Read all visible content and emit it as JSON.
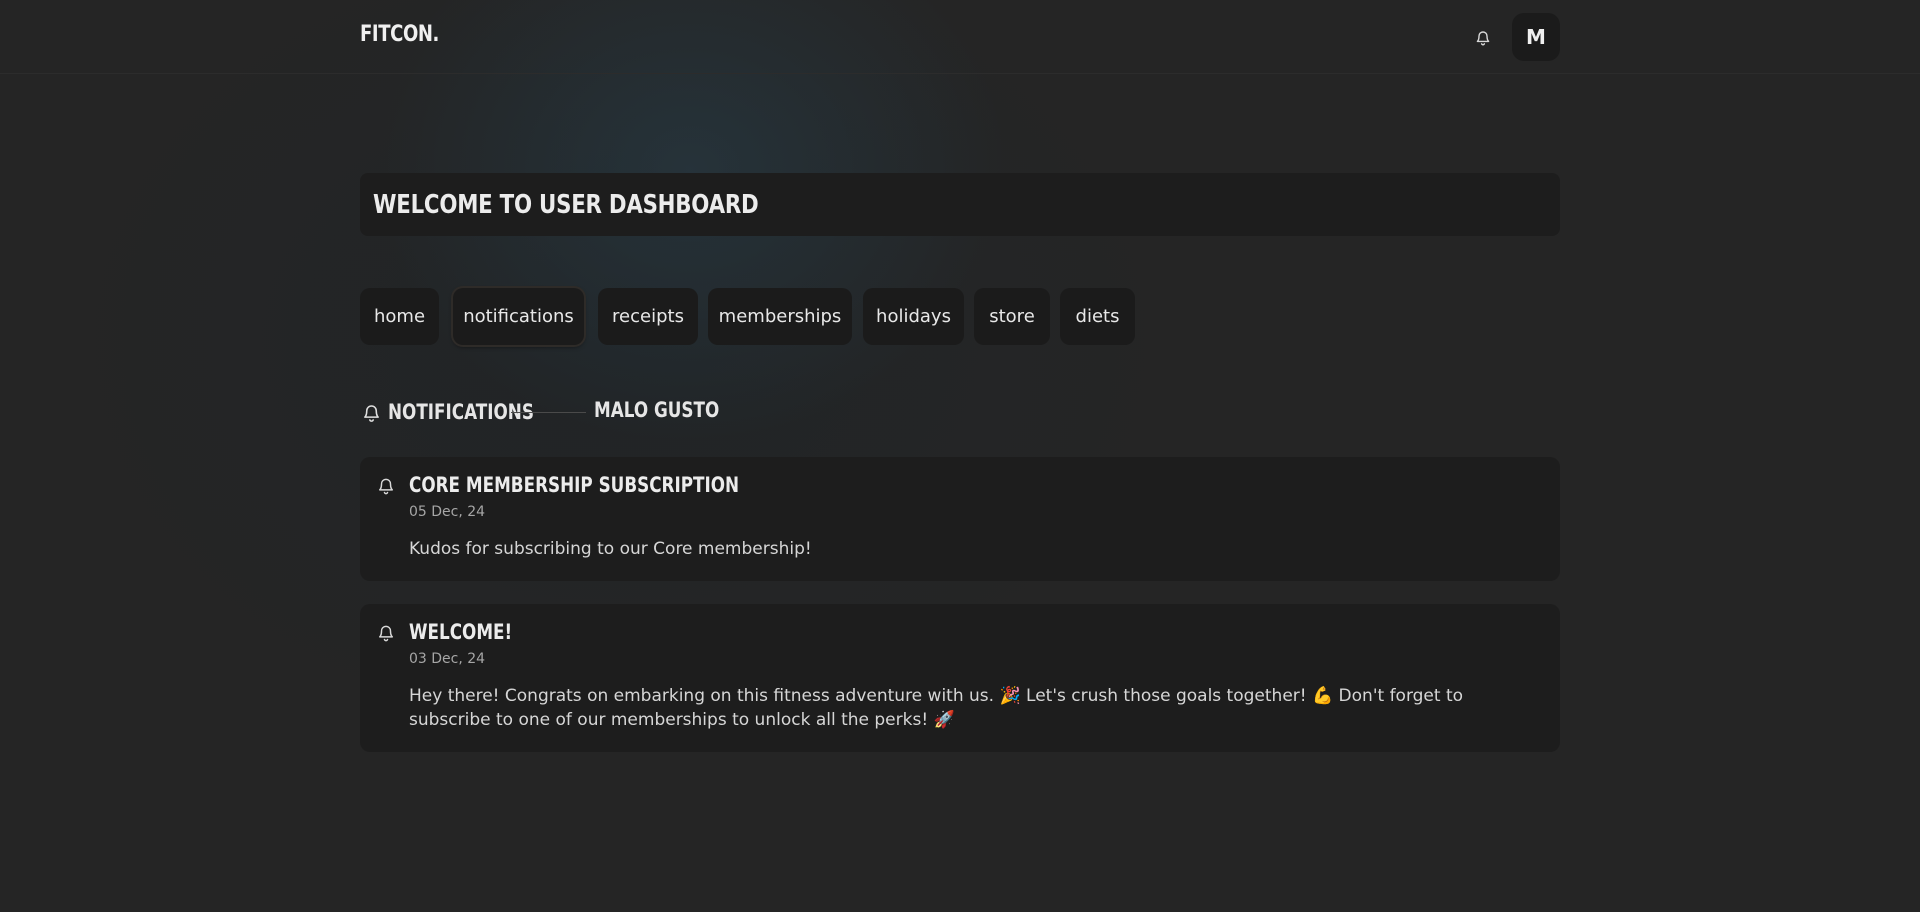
{
  "header": {
    "logo": "FITCON.",
    "avatar_initial": "M",
    "bell_icon": "bell-icon"
  },
  "welcome": {
    "title": "WELCOME TO USER DASHBOARD"
  },
  "tabs": [
    {
      "label": "home",
      "active": false
    },
    {
      "label": "notifications",
      "active": true
    },
    {
      "label": "receipts",
      "active": false
    },
    {
      "label": "memberships",
      "active": false
    },
    {
      "label": "holidays",
      "active": false
    },
    {
      "label": "store",
      "active": false
    },
    {
      "label": "diets",
      "active": false
    }
  ],
  "section": {
    "title": "NOTIFICATIONS",
    "user_name": "MALO GUSTO",
    "icon": "bell-icon"
  },
  "notifications": [
    {
      "title": "CORE MEMBERSHIP SUBSCRIPTION",
      "date": "05 Dec, 24",
      "body": "Kudos for subscribing to our Core membership!",
      "icon": "bell-icon"
    },
    {
      "title": "WELCOME!",
      "date": "03 Dec, 24",
      "body": "Hey there! Congrats on embarking on this fitness adventure with us. 🎉 Let's crush those goals together! 💪 Don't forget to subscribe to one of our memberships to unlock all the perks! 🚀",
      "icon": "bell-icon"
    }
  ],
  "colors": {
    "background": "#252525",
    "card": "#1d1d1d",
    "tab": "#1b1b1b",
    "text": "#e6e6e6",
    "muted": "#a6a6a6"
  }
}
